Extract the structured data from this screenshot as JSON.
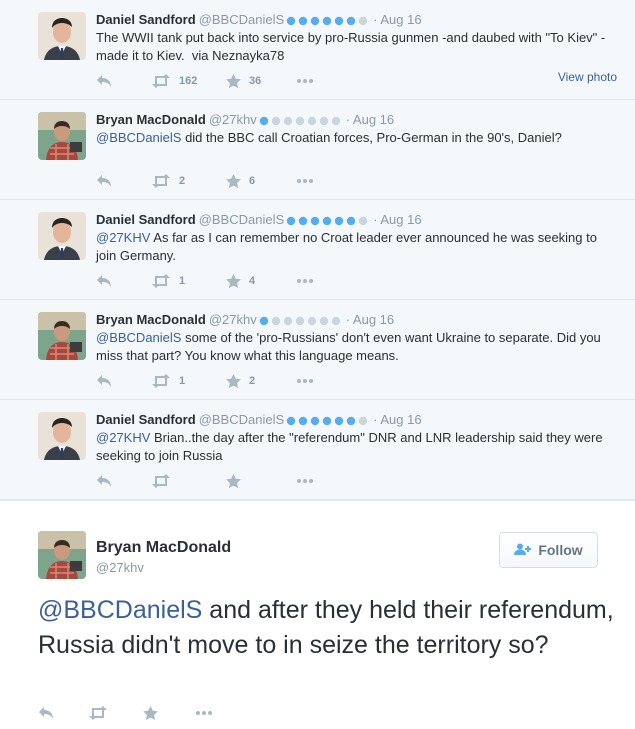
{
  "thread": [
    {
      "name": "Daniel Sandford",
      "handle": "@BBCDanielS",
      "date": "· Aug 16",
      "mention": "",
      "text": "The WWII tank put back into service by pro-Russia gunmen -and daubed with \"To Kiev\" -made it to Kiev.  via Neznayka78",
      "retweets": "162",
      "favorites": "36",
      "view_photo": "View photo"
    },
    {
      "name": "Bryan MacDonald",
      "handle": "@27khv",
      "date": "· Aug 16",
      "mention": "@BBCDanielS",
      "text": " did the BBC call Croatian forces, Pro-German in the 90's, Daniel?",
      "retweets": "2",
      "favorites": "6"
    },
    {
      "name": "Daniel Sandford",
      "handle": "@BBCDanielS",
      "date": "· Aug 16",
      "mention": "@27KHV",
      "text": " As far as I can remember no Croat leader ever announced he was seeking to join Germany.",
      "retweets": "1",
      "favorites": "4"
    },
    {
      "name": "Bryan MacDonald",
      "handle": "@27khv",
      "date": "· Aug 16",
      "mention": "@BBCDanielS",
      "text": " some of the 'pro-Russians' don't even want Ukraine to separate. Did you miss that part? You know what this language means.",
      "retweets": "1",
      "favorites": "2"
    },
    {
      "name": "Daniel Sandford",
      "handle": "@BBCDanielS",
      "date": "· Aug 16",
      "mention": "@27KHV",
      "text": " Brian..the day after the \"referendum\" DNR and LNR leadership said they were seeking to join Russia",
      "retweets": "",
      "favorites": ""
    }
  ],
  "main": {
    "name": "Bryan MacDonald",
    "handle": "@27khv",
    "follow_label": "Follow",
    "mention": "@BBCDanielS",
    "text": " and after they held their referendum, Russia didn't move to in seize the territory so?"
  },
  "colors": {
    "link": "#3b5f9d",
    "muted": "#8899a6",
    "verified": "#55acee"
  },
  "icons": [
    "reply-icon",
    "retweet-icon",
    "favorite-icon",
    "more-icon",
    "follow-person-icon"
  ]
}
